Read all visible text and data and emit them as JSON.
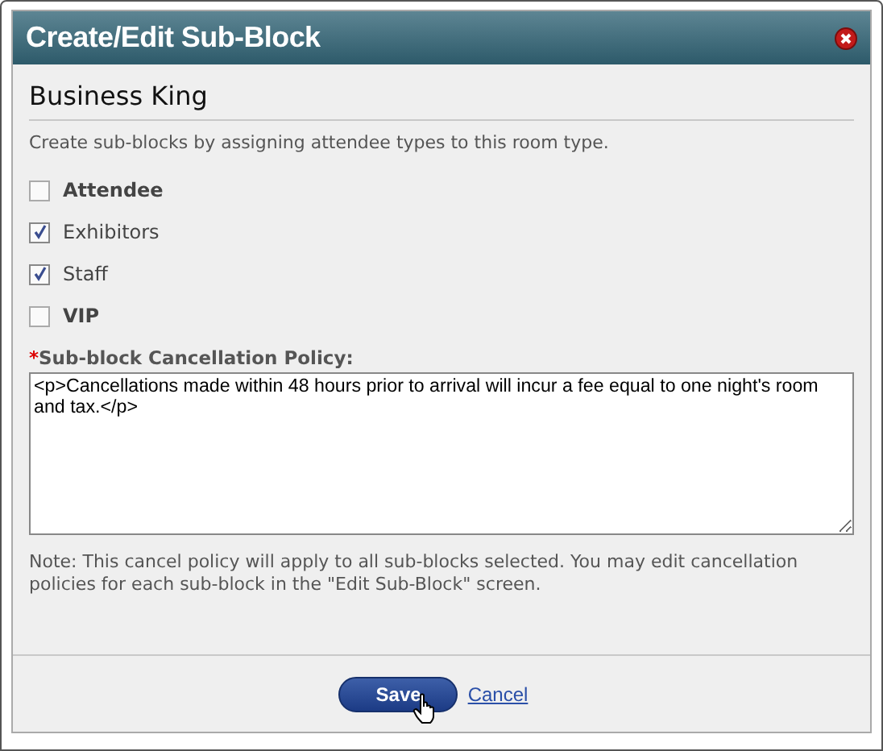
{
  "dialog": {
    "title": "Create/Edit Sub-Block",
    "heading": "Business King",
    "description": "Create sub-blocks by assigning attendee types to this room type.",
    "attendee_types": [
      {
        "label": "Attendee",
        "checked": false,
        "bold": true
      },
      {
        "label": "Exhibitors",
        "checked": true,
        "bold": false
      },
      {
        "label": "Staff",
        "checked": true,
        "bold": false
      },
      {
        "label": "VIP",
        "checked": false,
        "bold": true
      }
    ],
    "policy": {
      "label": "Sub-block Cancellation Policy:",
      "required_mark": "*",
      "value": "<p>Cancellations made within 48 hours prior to arrival will incur a fee equal to one night's room and tax.</p>"
    },
    "note": "Note: This cancel policy will apply to all sub-blocks selected. You may edit cancellation policies for each sub-block in the \"Edit Sub-Block\" screen.",
    "buttons": {
      "save": "Save",
      "cancel": "Cancel"
    }
  }
}
